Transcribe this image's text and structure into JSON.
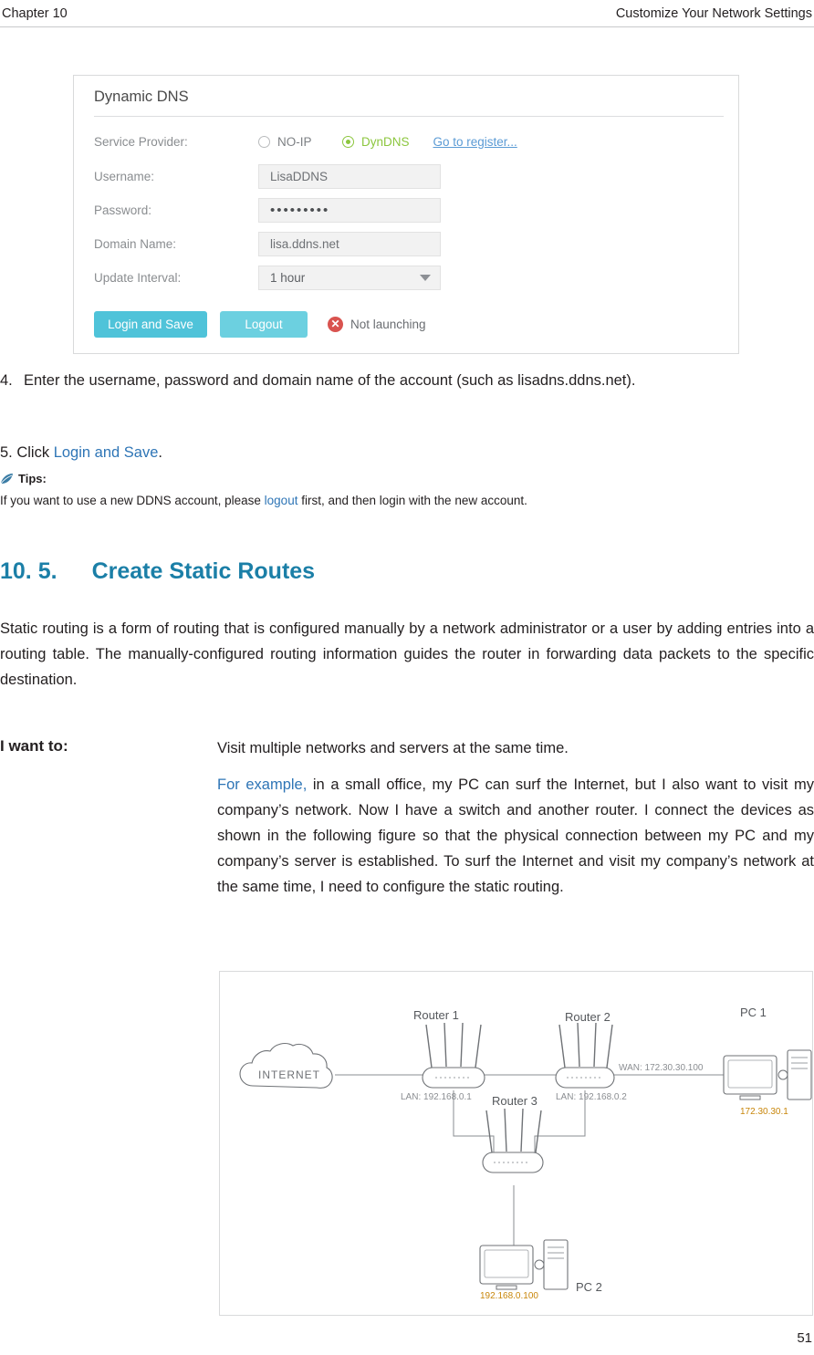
{
  "header": {
    "left": "Chapter 10",
    "right": "Customize Your Network Settings"
  },
  "screenshot": {
    "title": "Dynamic DNS",
    "rows": [
      {
        "label": "Service Provider:",
        "value": ""
      },
      {
        "label": "Username:",
        "value": "LisaDDNS"
      },
      {
        "label": "Password:",
        "value": "•••••••••"
      },
      {
        "label": "Domain Name:",
        "value": "lisa.ddns.net"
      },
      {
        "label": "Update Interval:",
        "value": "1 hour"
      }
    ],
    "providers": [
      {
        "label": "NO-IP",
        "selected": false
      },
      {
        "label": "DynDNS",
        "selected": true
      }
    ],
    "register_link": "Go to register...",
    "buttons": {
      "login_save": "Login and Save",
      "logout": "Logout"
    },
    "status": {
      "icon": "error-circle-icon",
      "text": "Not launching"
    },
    "colors": {
      "accent_green": "#8cc63e",
      "button_cyan": "#4fc3d9",
      "error_red": "#d9534f",
      "link_blue": "#5b9bd5"
    }
  },
  "steps": {
    "step4_num": "4.",
    "step4_text": "Enter the username, password and domain name of the account (such as lisadns.ddns.net).",
    "step5_pre": "5. Click ",
    "step5_link": "Login and Save",
    "step5_post": ".",
    "tips_label": "Tips:",
    "tips_pre": "If you want to use a new DDNS account, please ",
    "tips_link": "logout",
    "tips_post": " first, and then login with the new account."
  },
  "section": {
    "number": "10. 5.",
    "title": "Create Static Routes",
    "paragraph": "Static routing is a form of routing that is configured manually by a network administrator or a user by adding entries into a routing table. The manually-configured routing information guides the router in forwarding data packets to the specific destination."
  },
  "iwant": {
    "label": "I want to:",
    "line1": "Visit multiple networks and servers at the same time.",
    "example_lead": "For example,",
    "example_body": " in a small office, my PC can surf the Internet, but I also want to visit my company’s network. Now I have a switch and another router. I connect the devices as shown in the following figure so that the physical connection between my PC and my company’s server is established. To surf the Internet and visit my company’s network at the same time, I need to configure the static routing."
  },
  "diagram": {
    "internet": "INTERNET",
    "router1": "Router 1",
    "router2": "Router 2",
    "router3": "Router 3",
    "pc1": "PC 1",
    "pc2": "PC 2",
    "lan1": "LAN: 192.168.0.1",
    "lan2": "LAN: 192.168.0.2",
    "wan2": "WAN: 172.30.30.100",
    "pc1_ip": "172.30.30.1",
    "pc2_ip": "192.168.0.100"
  },
  "page_number": "51"
}
